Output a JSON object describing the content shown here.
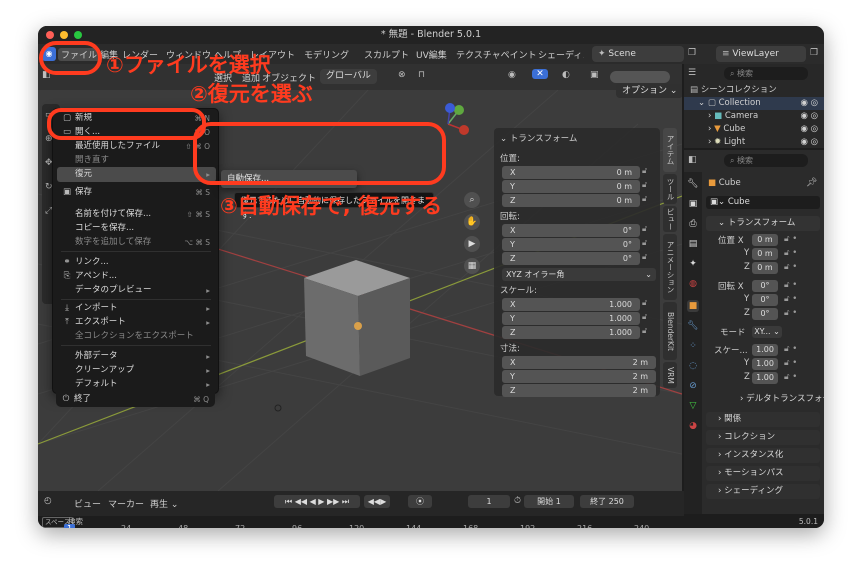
{
  "window": {
    "title": "* 無題 - Blender 5.0.1",
    "version": "5.0.1"
  },
  "menubar": {
    "items": [
      "ファイル",
      "編集",
      "レンダー",
      "ウィンドウ",
      "ヘルプ",
      "レイアウト",
      "モデリング",
      "スカルプト",
      "UV編集",
      "テクスチャペイント",
      "シェーディング"
    ],
    "scene": "Scene",
    "view_layer": "ViewLayer"
  },
  "viewport_header": {
    "select_label": "選択",
    "add_label": "追加",
    "object_label": "オブジェクト",
    "orientation": "グローバル",
    "options_label": "オプション"
  },
  "file_menu": {
    "items": [
      {
        "label": "新規",
        "shortcut": "⌘ N",
        "icon": "file-new-icon",
        "arrow": true
      },
      {
        "label": "開く...",
        "shortcut": "⌘ O",
        "icon": "folder-open-icon"
      },
      {
        "label": "最近使用したファイル",
        "shortcut": "⇧ ⌘ O",
        "arrow": true
      },
      {
        "label": "開き直す",
        "dim": true
      },
      {
        "label": "復元",
        "highlight": true,
        "arrow": true
      },
      {
        "label": "保存",
        "shortcut": "⌘ S",
        "icon": "save-icon"
      },
      {
        "label": "名前を付けて保存...",
        "shortcut": "⇧ ⌘ S"
      },
      {
        "label": "コピーを保存..."
      },
      {
        "label": "数字を追加して保存",
        "shortcut": "⌥ ⌘ S",
        "dim": true
      },
      {
        "label": "リンク...",
        "icon": "link-icon"
      },
      {
        "label": "アペンド...",
        "icon": "append-icon"
      },
      {
        "label": "データのプレビュー",
        "arrow": true
      },
      {
        "label": "インポート",
        "icon": "import-icon",
        "arrow": true
      },
      {
        "label": "エクスポート",
        "icon": "export-icon",
        "arrow": true
      },
      {
        "label": "全コレクションをエクスポート",
        "dim": true
      },
      {
        "label": "外部データ",
        "arrow": true
      },
      {
        "label": "クリーンアップ",
        "arrow": true
      },
      {
        "label": "デフォルト",
        "arrow": true
      },
      {
        "label": "終了",
        "shortcut": "⌘ Q",
        "icon": "power-icon"
      }
    ],
    "submenu_item": "自動保存...",
    "tooltip": "復元するために自動的に保存したファイルを開きます."
  },
  "annotations": {
    "step1": "①ファイルを選択",
    "step2": "②復元を選ぶ",
    "step3": "③自動保存で, 復元する",
    "color": "#ff3b1f"
  },
  "n_panel": {
    "title": "トランスフォーム",
    "location_label": "位置:",
    "location": [
      {
        "axis": "X",
        "value": "0 m"
      },
      {
        "axis": "Y",
        "value": "0 m"
      },
      {
        "axis": "Z",
        "value": "0 m"
      }
    ],
    "rotation_label": "回転:",
    "rotation": [
      {
        "axis": "X",
        "value": "0°"
      },
      {
        "axis": "Y",
        "value": "0°"
      },
      {
        "axis": "Z",
        "value": "0°"
      }
    ],
    "rotation_mode": "XYZ オイラー角",
    "scale_label": "スケール:",
    "scale": [
      {
        "axis": "X",
        "value": "1.000"
      },
      {
        "axis": "Y",
        "value": "1.000"
      },
      {
        "axis": "Z",
        "value": "1.000"
      }
    ],
    "dimensions_label": "寸法:",
    "dimensions": [
      {
        "axis": "X",
        "value": "2 m"
      },
      {
        "axis": "Y",
        "value": "2 m"
      },
      {
        "axis": "Z",
        "value": "2 m"
      }
    ]
  },
  "side_tabs": [
    "アイテム",
    "ツール",
    "ビュー",
    "アニメーション",
    "BlenderKit",
    "VRM"
  ],
  "outliner": {
    "search_placeholder": "検索",
    "root": "シーンコレクション",
    "collection": "Collection",
    "items": [
      "Camera",
      "Cube",
      "Light"
    ]
  },
  "properties": {
    "search_placeholder": "検索",
    "object_name": "Cube",
    "mesh_name": "Cube",
    "transform_title": "トランスフォーム",
    "location_label": "位置 X",
    "location": [
      "0 m",
      "0 m",
      "0 m"
    ],
    "rotation_label": "回転 X",
    "rotation": [
      "0°",
      "0°",
      "0°"
    ],
    "mode_label": "モード",
    "mode_value": "XY...",
    "scale_label": "スケー...",
    "scale": [
      "1.00",
      "1.00",
      "1.00"
    ],
    "axis_y": "Y",
    "axis_z": "Z",
    "delta_label": "デルタトランスフォーム",
    "sections": [
      "関係",
      "コレクション",
      "インスタンス化",
      "モーションパス",
      "シェーディング"
    ]
  },
  "timeline": {
    "view_label": "ビュー",
    "marker_label": "マーカー",
    "playback_label": "再生",
    "current_frame": "1",
    "start_label": "開始",
    "start_value": "1",
    "end_label": "終了",
    "end_value": "250",
    "ruler": [
      "1",
      "24",
      "48",
      "72",
      "96",
      "120",
      "144",
      "168",
      "192",
      "216",
      "240"
    ]
  },
  "statusbar": {
    "key": "スペース",
    "action": "検索"
  }
}
